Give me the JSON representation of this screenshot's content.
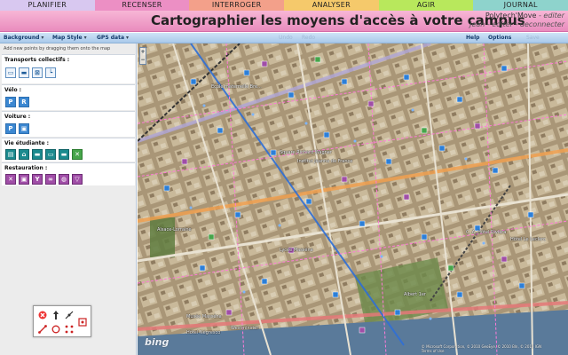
{
  "nav": {
    "tabs": [
      {
        "label": "PLANIFIER",
        "color": "#d8c8f0"
      },
      {
        "label": "RECENSER",
        "color": "#ec8fc4"
      },
      {
        "label": "INTERROGER",
        "color": "#f3a08a"
      },
      {
        "label": "ANALYSER",
        "color": "#f5c96b"
      },
      {
        "label": "AGIR",
        "color": "#b8e85c"
      },
      {
        "label": "JOURNAL",
        "color": "#8ed3cc"
      }
    ]
  },
  "header": {
    "title": "Cartographier les moyens d'accès à votre campus",
    "brand": "Polytech'Move",
    "brand_link": "- editer",
    "user": "Jean",
    "user_links": "- editer - deconnecter"
  },
  "toolbar": {
    "background": "Background",
    "map_style": "Map Style",
    "gps_data": "GPS data",
    "undo": "Undo",
    "redo": "Redo",
    "help": "Help",
    "options": "Options",
    "save": "Save"
  },
  "panel": {
    "hint": "Add new points by dragging them onto the map",
    "sections": [
      {
        "title": "Transports collectifs :",
        "icons": [
          "bus-icon",
          "tram-icon",
          "train-icon",
          "metro-icon"
        ]
      },
      {
        "title": "Vélo :",
        "icons": [
          "bike-parking-icon",
          "bike-rental-icon"
        ]
      },
      {
        "title": "Voiture :",
        "icons": [
          "car-parking-icon",
          "car-rental-icon"
        ]
      },
      {
        "title": "Vie étudiante :",
        "icons": [
          "library-icon",
          "campus-icon",
          "sport-icon",
          "housing-icon",
          "cinema-icon",
          "activity-icon"
        ]
      },
      {
        "title": "Restauration :",
        "icons": [
          "restaurant-icon",
          "cafe-icon",
          "bar-icon",
          "bakery-icon",
          "fastfood-icon",
          "market-icon"
        ]
      }
    ]
  },
  "map": {
    "labels": [
      "Ecole maternelle Bre...",
      "Square Richard Wagner",
      "Institut Jeanne de France",
      "Alsace-Lorraine",
      "Lycée Masséna",
      "Musée Masséna",
      "Hôtel Négresco",
      "Westminster",
      "C. A. Hôtel Riviera",
      "Hôtel Le Leclerc",
      "Albert 1er"
    ],
    "bing": "bing",
    "copyright": "© Microsoft Corporation, © 2010 GeoEye, © 2010 Bln, © 2010 IGN",
    "terms": "Terms of Use"
  }
}
